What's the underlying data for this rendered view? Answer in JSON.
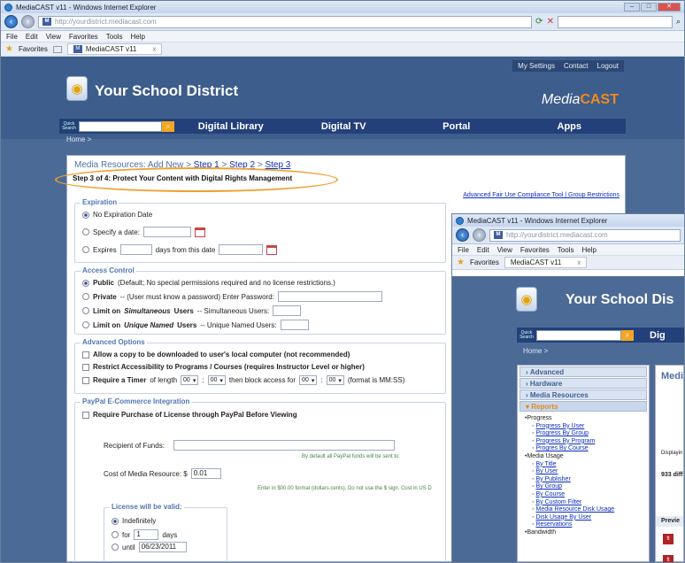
{
  "window": {
    "title": "MediaCAST v11 - Windows Internet Explorer",
    "url": "http://yourdistrict.mediacast.com",
    "menu": [
      "File",
      "Edit",
      "View",
      "Favorites",
      "Tools",
      "Help"
    ],
    "favorites_label": "Favorites",
    "tab_label": "MediaCAST v11"
  },
  "header": {
    "top_links": [
      "My Settings",
      "Contact",
      "Logout"
    ],
    "site_name": "Your School District",
    "brand_media": "Media",
    "brand_cast": "CAST",
    "quick_search_label": "Quick Search",
    "nav": [
      "Digital Library",
      "Digital TV",
      "Portal",
      "Apps"
    ],
    "breadcrumb": "Home >"
  },
  "content": {
    "title_prefix": "Media Resources: Add New >",
    "steps": [
      "Step 1",
      "Step 2",
      "Step 3"
    ],
    "step_sep": ">",
    "step_heading": "Step 3 of 4: Protect Your Content with Digital Rights Management",
    "tool_links": "Advanced Fair Use Compliance Tool | Group Restrictions",
    "expiration": {
      "legend": "Expiration",
      "no_expiration": "No Expiration Date",
      "specify_date": "Specify a date:",
      "expires": "Expires",
      "days_from": "days from this date"
    },
    "access": {
      "legend": "Access Control",
      "public_bold": "Public",
      "public_rest": "(Default; No special permissions required and no license restrictions.)",
      "private_bold": "Private",
      "private_rest": "-- (User must know a password) Enter Password:",
      "limit_sim_a": "Limit on",
      "limit_sim_b": "Simultaneous",
      "limit_sim_c": "Users",
      "limit_sim_d": "-- Simultaneous Users:",
      "limit_named_a": "Limit on",
      "limit_named_b": "Unique Named",
      "limit_named_c": "Users",
      "limit_named_d": "-- Unique Named Users:"
    },
    "advanced": {
      "legend": "Advanced Options",
      "opt1": "Allow a copy to be downloaded to user's local computer (not recommended)",
      "opt2": "Restrict Accessibility to Programs / Courses (requires Instructor Level or higher)",
      "opt3_a": "Require a Timer",
      "opt3_b": "of length",
      "opt3_c": "then block access for",
      "opt3_d": "(format is MM:SS)",
      "time_val": "00",
      "colon": ":"
    },
    "paypal": {
      "legend": "PayPal E-Commerce Integration",
      "require": "Require Purchase of License through PayPal Before Viewing",
      "recipient_label": "Recipient of Funds:",
      "recipient_hint": "By default all PayPal funds will be sent to:",
      "cost_label": "Cost of Media Resource: $",
      "cost_value": "0.01",
      "cost_hint": "Enter in $00.00 format (dollars.cents). Do not use the $ sign. Cost in US D",
      "license_legend": "License will be valid:",
      "indefinitely": "Indefinitely",
      "for_label": "for",
      "for_value": "1",
      "days": "days",
      "until_label": "until",
      "until_value": "06/23/2011"
    }
  },
  "window2": {
    "site_name": "Your School Dis",
    "quick_search_label": "Quick Search",
    "nav_partial": "Dig",
    "breadcrumb": "Home >",
    "accordion": [
      "Advanced",
      "Hardware",
      "Media Resources"
    ],
    "active_section": "Reports",
    "tree": [
      {
        "t": "Progress",
        "l": 1
      },
      {
        "t": "Progress By User",
        "l": 2
      },
      {
        "t": "Progress By Group",
        "l": 2
      },
      {
        "t": "Progress By Program",
        "l": 2
      },
      {
        "t": "Progres By Course",
        "l": 2
      },
      {
        "t": "Media Usage",
        "l": 1
      },
      {
        "t": "By Title",
        "l": 2
      },
      {
        "t": "By User",
        "l": 2
      },
      {
        "t": "By Publisher",
        "l": 2
      },
      {
        "t": "By Group",
        "l": 2
      },
      {
        "t": "By Course",
        "l": 2
      },
      {
        "t": "By Custom Filter",
        "l": 2
      },
      {
        "t": "Media Resource Disk Usage",
        "l": 2
      },
      {
        "t": "Disk Usage By User",
        "l": 2
      },
      {
        "t": "Reservations",
        "l": 2
      },
      {
        "t": "Bandwidth",
        "l": 1
      }
    ],
    "main_title": "Medi",
    "displaying": "Displayin",
    "diff": "933 diff",
    "preview": "Previe"
  }
}
